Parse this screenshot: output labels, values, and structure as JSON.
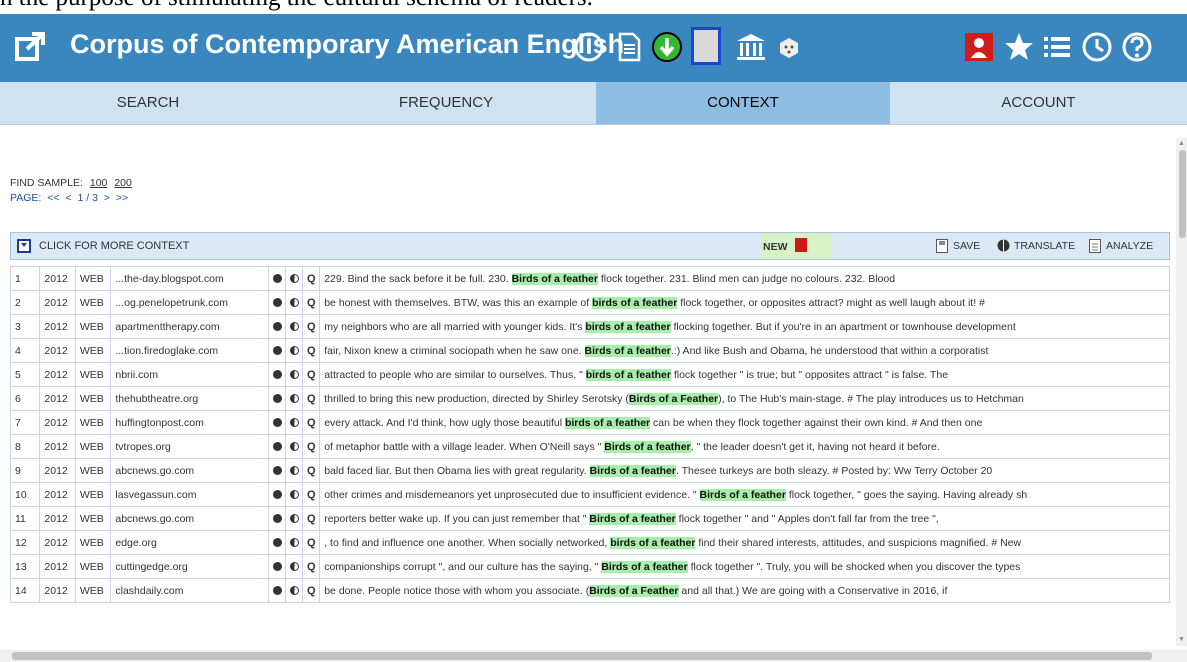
{
  "caption_top": "n the purpose of stimulating the cultural schema of readers.",
  "header": {
    "title": "Corpus of Contemporary American English",
    "bg_color": "#3a87c0"
  },
  "tabs": [
    {
      "label": "SEARCH",
      "active": false
    },
    {
      "label": "FREQUENCY",
      "active": false
    },
    {
      "label": "CONTEXT",
      "active": true
    },
    {
      "label": "ACCOUNT",
      "active": false
    }
  ],
  "find_sample": {
    "label": "FIND SAMPLE:",
    "opt1": "100",
    "opt2": "200"
  },
  "pager": {
    "label": "PAGE:",
    "first": "<<",
    "prev": "<",
    "current": "1 / 3",
    "next": ">",
    "last": ">>"
  },
  "toolbar": {
    "more_context": "CLICK FOR MORE CONTEXT",
    "new_label": "NEW",
    "save": "SAVE",
    "translate": "TRANSLATE",
    "analyze": "ANALYZE"
  },
  "rows": [
    {
      "n": "1",
      "year": "2012",
      "genre": "WEB",
      "source": "...the-day.blogspot.com",
      "pre": "229. Bind the sack before it be full. 230. ",
      "hit": "Birds of a feather",
      "post": " flock together. 231. Blind men can judge no colours. 232. Blood"
    },
    {
      "n": "2",
      "year": "2012",
      "genre": "WEB",
      "source": "...og.penelopetrunk.com",
      "pre": "be honest with themselves. BTW, was this an example of ",
      "hit": "birds of a feather",
      "post": " flock together, or opposites attract? might as well laugh about it! #"
    },
    {
      "n": "3",
      "year": "2012",
      "genre": "WEB",
      "source": "apartmenttherapy.com",
      "pre": "my neighbors who are all married with younger kids. It's ",
      "hit": "birds of a feather",
      "post": " flocking together. But if you're in an apartment or townhouse development"
    },
    {
      "n": "4",
      "year": "2012",
      "genre": "WEB",
      "source": "...tion.firedoglake.com",
      "pre": "fair, Nixon knew a criminal sociopath when he saw one. ",
      "hit": "Birds of a feather",
      "post": ".:) And like Bush and Obama, he understood that within a corporatist"
    },
    {
      "n": "5",
      "year": "2012",
      "genre": "WEB",
      "source": "nbrii.com",
      "pre": "attracted to people who are similar to ourselves. Thus, \" ",
      "hit": "birds of a feather",
      "post": " flock together \" is true; but \" opposites attract \" is false. The"
    },
    {
      "n": "6",
      "year": "2012",
      "genre": "WEB",
      "source": "thehubtheatre.org",
      "pre": "thrilled to bring this new production, directed by Shirley Serotsky (",
      "hit": "Birds of a Feather",
      "post": "), to The Hub's main-stage. # The play introduces us to Hetchman"
    },
    {
      "n": "7",
      "year": "2012",
      "genre": "WEB",
      "source": "huffingtonpost.com",
      "pre": "every attack. And I'd think, how ugly those beautiful ",
      "hit": "birds of a feather",
      "post": " can be when they flock together against their own kind. # And then one"
    },
    {
      "n": "8",
      "year": "2012",
      "genre": "WEB",
      "source": "tvtropes.org",
      "pre": "of metaphor battle with a village leader. When O'Neill says \" ",
      "hit": "Birds of a feather",
      "post": ", \" the leader doesn't get it, having not heard it before."
    },
    {
      "n": "9",
      "year": "2012",
      "genre": "WEB",
      "source": "abcnews.go.com",
      "pre": "bald faced liar. But then Obama lies with great regularity. ",
      "hit": "Birds of a feather",
      "post": ". Thesee turkeys are both sleazy. # Posted by: Ww Terry October 20"
    },
    {
      "n": "10",
      "year": "2012",
      "genre": "WEB",
      "source": "lasvegassun.com",
      "pre": "other crimes and misdemeanors yet unprosecuted due to insufficient evidence. \" ",
      "hit": "Birds of a feather",
      "post": " flock together, \" goes the saying. Having already sh"
    },
    {
      "n": "11",
      "year": "2012",
      "genre": "WEB",
      "source": "abcnews.go.com",
      "pre": "reporters better wake up. If you can just remember that \" ",
      "hit": "Birds of a feather",
      "post": " flock together \" and \" Apples don't fall far from the tree \","
    },
    {
      "n": "12",
      "year": "2012",
      "genre": "WEB",
      "source": "edge.org",
      "pre": ", to find and influence one another. When socially networked, ",
      "hit": "birds of a feather",
      "post": " find their shared interests, attitudes, and suspicions magnified. # New"
    },
    {
      "n": "13",
      "year": "2012",
      "genre": "WEB",
      "source": "cuttingedge.org",
      "pre": "companionships corrupt \", and our culture has the saying, \" ",
      "hit": "Birds of a feather",
      "post": " flock together \". Truly, you will be shocked when you discover the types"
    },
    {
      "n": "14",
      "year": "2012",
      "genre": "WEB",
      "source": "clashdaily.com",
      "pre": "be done. People notice those with whom you associate. (",
      "hit": "Birds of a Feather",
      "post": " and all that.) We are going with a Conservative in 2016, if"
    }
  ]
}
